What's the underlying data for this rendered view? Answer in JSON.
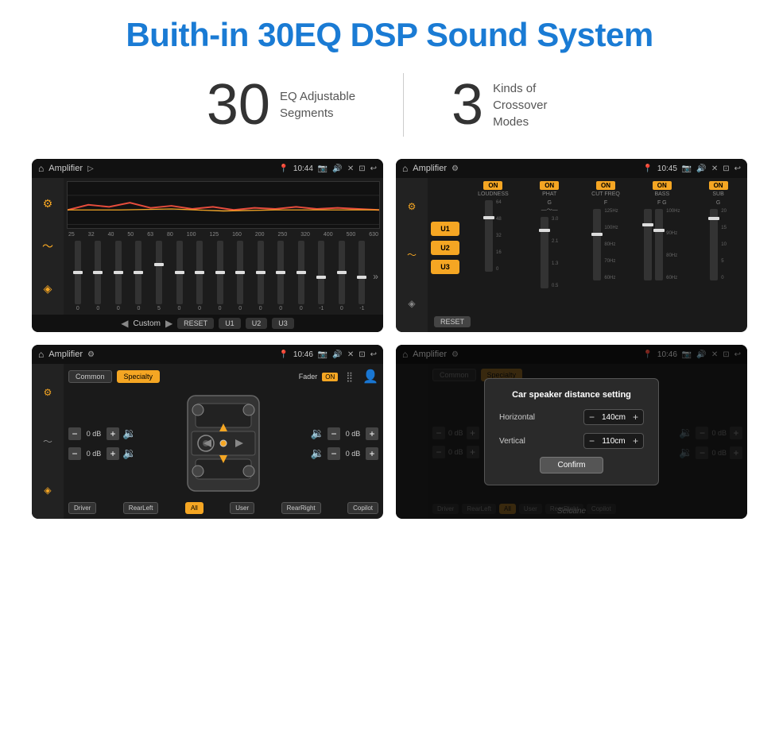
{
  "page": {
    "title": "Buith-in 30EQ DSP Sound System",
    "stat1_number": "30",
    "stat1_label": "EQ Adjustable\nSegments",
    "stat2_number": "3",
    "stat2_label": "Kinds of\nCrossover Modes"
  },
  "screen1": {
    "title": "Amplifier",
    "time": "10:44",
    "freq_labels": [
      "25",
      "32",
      "40",
      "50",
      "63",
      "80",
      "100",
      "125",
      "160",
      "200",
      "250",
      "320",
      "400",
      "500",
      "630"
    ],
    "slider_values": [
      "0",
      "0",
      "0",
      "0",
      "5",
      "0",
      "0",
      "0",
      "0",
      "0",
      "0",
      "0",
      "-1",
      "0",
      "-1"
    ],
    "nav_items": [
      "Custom",
      "RESET",
      "U1",
      "U2",
      "U3"
    ]
  },
  "screen2": {
    "title": "Amplifier",
    "time": "10:45",
    "presets": [
      "U1",
      "U2",
      "U3"
    ],
    "channels": [
      "LOUDNESS",
      "PHAT",
      "CUT FREQ",
      "BASS",
      "SUB"
    ],
    "active_preset": "U3",
    "reset_label": "RESET"
  },
  "screen3": {
    "title": "Amplifier",
    "time": "10:46",
    "presets": [
      "Common",
      "Specialty"
    ],
    "fader_label": "Fader",
    "on_label": "ON",
    "vol_controls": [
      {
        "value": "0 dB"
      },
      {
        "value": "0 dB"
      },
      {
        "value": "0 dB"
      },
      {
        "value": "0 dB"
      }
    ],
    "zones": [
      "Driver",
      "RearLeft",
      "All",
      "User",
      "RearRight",
      "Copilot"
    ]
  },
  "screen4": {
    "title": "Amplifier",
    "time": "10:46",
    "dialog": {
      "title": "Car speaker distance setting",
      "horizontal_label": "Horizontal",
      "horizontal_value": "140cm",
      "vertical_label": "Vertical",
      "vertical_value": "110cm",
      "confirm_label": "Confirm"
    },
    "vol_controls": [
      {
        "value": "0 dB"
      },
      {
        "value": "0 dB"
      }
    ],
    "zones": [
      "Driver",
      "RearLeft",
      "All",
      "Copilot",
      "RearRight"
    ]
  },
  "watermark": "Seicane"
}
